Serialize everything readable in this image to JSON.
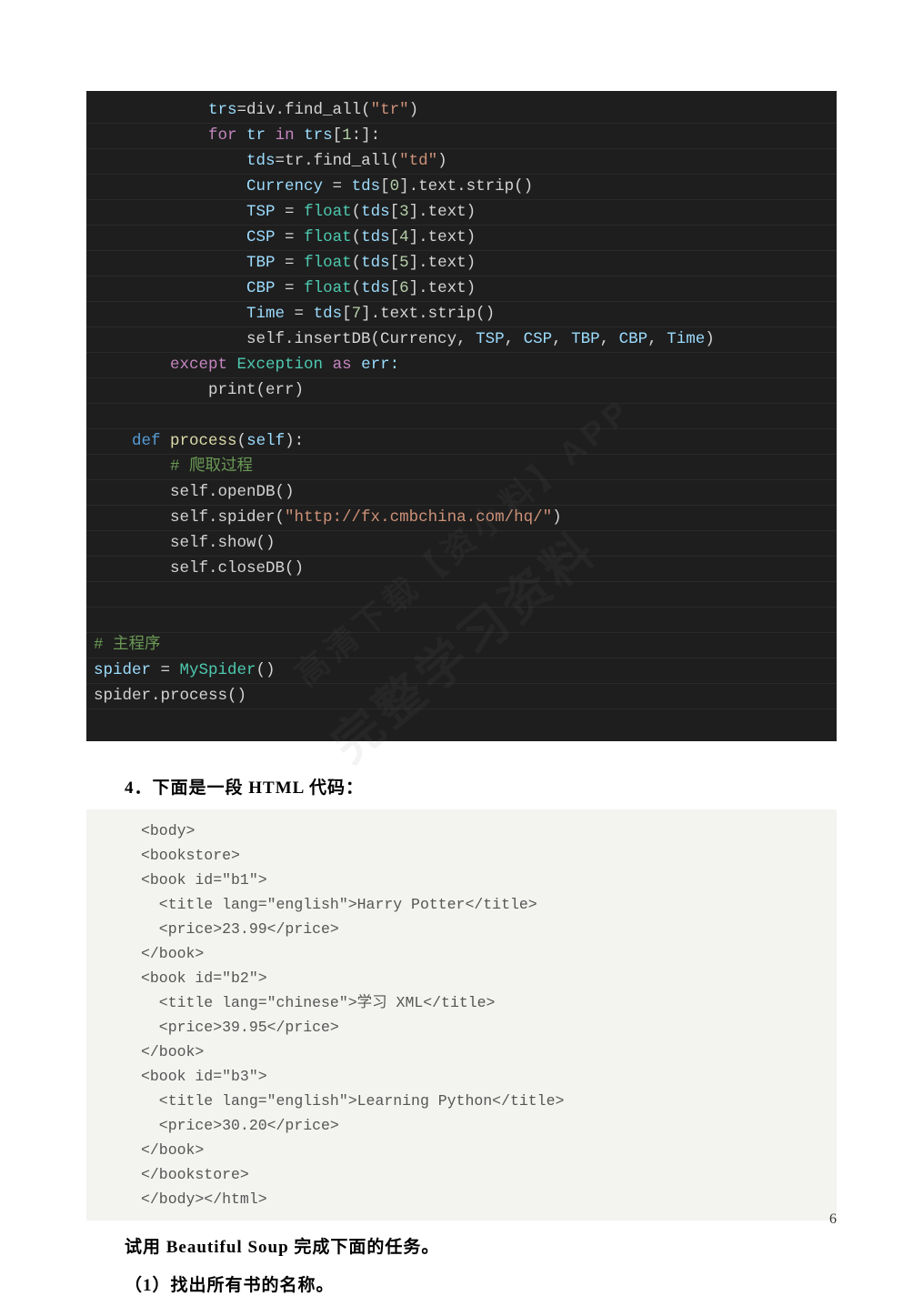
{
  "darkcode": {
    "lines": [
      [
        [
          "            trs",
          "var"
        ],
        [
          "=",
          "default"
        ],
        [
          "div.find_all(",
          "default"
        ],
        [
          "\"tr\"",
          "string"
        ],
        [
          ")",
          "default"
        ]
      ],
      [
        [
          "            ",
          "default"
        ],
        [
          "for ",
          "keyword"
        ],
        [
          "tr",
          "var"
        ],
        [
          " in ",
          "keyword"
        ],
        [
          "trs",
          "var"
        ],
        [
          "[",
          "default"
        ],
        [
          "1",
          "number"
        ],
        [
          ":]:",
          "default"
        ]
      ],
      [
        [
          "                tds",
          "var"
        ],
        [
          "=",
          "default"
        ],
        [
          "tr.find_all(",
          "default"
        ],
        [
          "\"td\"",
          "string"
        ],
        [
          ")",
          "default"
        ]
      ],
      [
        [
          "                Currency ",
          "var"
        ],
        [
          "= ",
          "default"
        ],
        [
          "tds",
          "var"
        ],
        [
          "[",
          "default"
        ],
        [
          "0",
          "number"
        ],
        [
          "]",
          "default"
        ],
        [
          ".text.strip()",
          "default"
        ]
      ],
      [
        [
          "                TSP ",
          "var"
        ],
        [
          "= ",
          "default"
        ],
        [
          "float",
          "class"
        ],
        [
          "(",
          "default"
        ],
        [
          "tds",
          "var"
        ],
        [
          "[",
          "default"
        ],
        [
          "3",
          "number"
        ],
        [
          "]",
          "default"
        ],
        [
          ".text)",
          "default"
        ]
      ],
      [
        [
          "                CSP ",
          "var"
        ],
        [
          "= ",
          "default"
        ],
        [
          "float",
          "class"
        ],
        [
          "(",
          "default"
        ],
        [
          "tds",
          "var"
        ],
        [
          "[",
          "default"
        ],
        [
          "4",
          "number"
        ],
        [
          "]",
          "default"
        ],
        [
          ".text)",
          "default"
        ]
      ],
      [
        [
          "                TBP ",
          "var"
        ],
        [
          "= ",
          "default"
        ],
        [
          "float",
          "class"
        ],
        [
          "(",
          "default"
        ],
        [
          "tds",
          "var"
        ],
        [
          "[",
          "default"
        ],
        [
          "5",
          "number"
        ],
        [
          "]",
          "default"
        ],
        [
          ".text)",
          "default"
        ]
      ],
      [
        [
          "                CBP ",
          "var"
        ],
        [
          "= ",
          "default"
        ],
        [
          "float",
          "class"
        ],
        [
          "(",
          "default"
        ],
        [
          "tds",
          "var"
        ],
        [
          "[",
          "default"
        ],
        [
          "6",
          "number"
        ],
        [
          "]",
          "default"
        ],
        [
          ".text)",
          "default"
        ]
      ],
      [
        [
          "                Time ",
          "var"
        ],
        [
          "= ",
          "default"
        ],
        [
          "tds",
          "var"
        ],
        [
          "[",
          "default"
        ],
        [
          "7",
          "number"
        ],
        [
          "]",
          "default"
        ],
        [
          ".text.strip()",
          "default"
        ]
      ],
      [
        [
          "                self.insertDB(Currency, ",
          "default"
        ],
        [
          "TSP",
          "var"
        ],
        [
          ", ",
          "default"
        ],
        [
          "CSP",
          "var"
        ],
        [
          ", ",
          "default"
        ],
        [
          "TBP",
          "var"
        ],
        [
          ", ",
          "default"
        ],
        [
          "CBP",
          "var"
        ],
        [
          ", ",
          "default"
        ],
        [
          "Time",
          "var"
        ],
        [
          ")",
          "default"
        ]
      ],
      [
        [
          "        ",
          "default"
        ],
        [
          "except ",
          "keyword"
        ],
        [
          "Exception ",
          "class"
        ],
        [
          "as ",
          "keyword"
        ],
        [
          "err:",
          "var"
        ]
      ],
      [
        [
          "            print(err)",
          "default"
        ]
      ],
      [
        [
          "",
          "default"
        ]
      ],
      [
        [
          "    ",
          "default"
        ],
        [
          "def ",
          "def"
        ],
        [
          "process",
          "func"
        ],
        [
          "(",
          "default"
        ],
        [
          "self",
          "var"
        ],
        [
          "):",
          "default"
        ]
      ],
      [
        [
          "        ",
          "default"
        ],
        [
          "# 爬取过程",
          "comment"
        ]
      ],
      [
        [
          "        self.openDB()",
          "default"
        ]
      ],
      [
        [
          "        self.spider(",
          "default"
        ],
        [
          "\"http://fx.cmbchina.com/hq/\"",
          "string"
        ],
        [
          ")",
          "default"
        ]
      ],
      [
        [
          "        self.show()",
          "default"
        ]
      ],
      [
        [
          "        self.closeDB()",
          "default"
        ]
      ],
      [
        [
          "",
          "default"
        ]
      ],
      [
        [
          "",
          "default"
        ]
      ],
      [
        [
          "# 主程序",
          "comment"
        ]
      ],
      [
        [
          "spider ",
          "var"
        ],
        [
          "= ",
          "default"
        ],
        [
          "MySpider",
          "class"
        ],
        [
          "()",
          "default"
        ]
      ],
      [
        [
          "spider.process()",
          "default"
        ]
      ],
      [
        [
          "",
          "default"
        ]
      ]
    ]
  },
  "question_heading": "4．下面是一段 HTML 代码：",
  "html_code": "<body>\n<bookstore>\n<book id=\"b1\">\n  <title lang=\"english\">Harry Potter</title>\n  <price>23.99</price>\n</book>\n<book id=\"b2\">\n  <title lang=\"chinese\">学习 XML</title>\n  <price>39.95</price>\n</book>\n<book id=\"b3\">\n  <title lang=\"english\">Learning Python</title>\n  <price>30.20</price>\n</book>\n</bookstore>\n</body></html>",
  "task_line": "试用 Beautiful Soup 完成下面的任务。",
  "subtask_line": "（1）找出所有书的名称。",
  "page_number": "6",
  "watermark_main": "完整学习资料",
  "watermark_sub": "高清下载【资小料】APP"
}
